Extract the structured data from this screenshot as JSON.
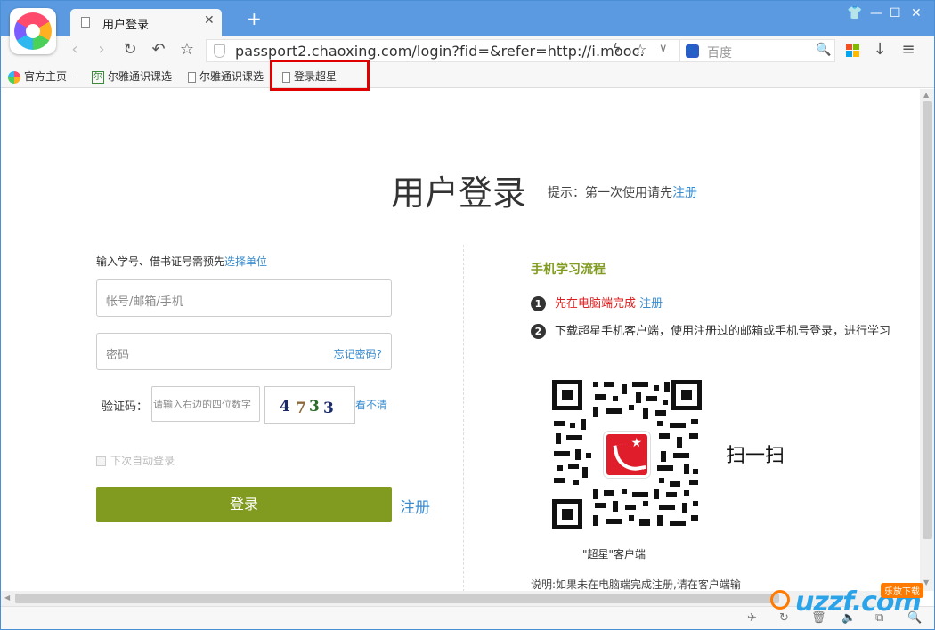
{
  "browser": {
    "tab_title": "用户登录",
    "tab_close": "✕",
    "new_tab": "+",
    "url": "passport2.chaoxing.com/login?fid=&refer=http://i.mooc.",
    "search_placeholder": "百度",
    "search_engine_glyph": "🐾"
  },
  "bookmarks": [
    {
      "label": "官方主页 -"
    },
    {
      "label": "尔雅通识课选"
    },
    {
      "label": "尔雅通识课选"
    },
    {
      "label": "登录超星"
    }
  ],
  "page": {
    "title": "用户登录",
    "hint_text": "提示：第一次使用请先",
    "hint_link": "注册"
  },
  "login": {
    "prompt_text": "输入学号、借书证号需预先",
    "prompt_link": "选择单位",
    "account_placeholder": "帐号/邮箱/手机",
    "password_placeholder": "密码",
    "forgot_password": "忘记密码?",
    "captcha_label": "验证码：",
    "captcha_placeholder": "请输入右边的四位数字",
    "captcha_chars": [
      "4",
      "7",
      "3",
      "3"
    ],
    "captcha_refresh": "看不清",
    "auto_login": "下次自动登录",
    "submit": "登录",
    "register": "注册"
  },
  "mobile": {
    "title": "手机学习流程",
    "step1_num": "1",
    "step1_red": "先在电脑端完成",
    "step1_link": "注册",
    "step2_num": "2",
    "step2_text": "下载超星手机客户端，使用注册过的邮箱或手机号登录，进行学习",
    "scan_label": "扫一扫",
    "qr_caption": "\"超星\"客户端",
    "note": "说明:如果未在电脑端完成注册,请在客户端输"
  },
  "watermark": {
    "text": "uzzf.com",
    "badge": "乐放下载"
  },
  "colors": {
    "titlebar": "#5b9ae0",
    "accent_green": "#819b21",
    "link_blue": "#3a8cd0",
    "highlight_red": "#e00000"
  }
}
